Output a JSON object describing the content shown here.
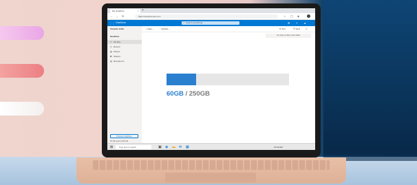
{
  "browser": {
    "tab_title": "My OneDrive",
    "tab_close": "×",
    "new_tab": "+",
    "nav": [
      "←",
      "→",
      "⟳"
    ],
    "url": "https://onedrive.live.com",
    "menu": "⋯"
  },
  "header": {
    "app_title": "OneDrive",
    "search_placeholder": "Search everything",
    "icons": [
      "gear-icon",
      "help-icon",
      "avatar"
    ]
  },
  "sidebar": {
    "user_name": "Vinnette Jellis",
    "section": "OneDrive",
    "items": [
      {
        "label": "My files",
        "icon": "folder-icon",
        "active": true
      },
      {
        "label": "Recent",
        "icon": "clock-icon",
        "active": false
      },
      {
        "label": "Photos",
        "icon": "photo-icon",
        "active": false
      },
      {
        "label": "Shared",
        "icon": "share-icon",
        "active": false
      },
      {
        "label": "Recycle bin",
        "icon": "trash-icon",
        "active": false
      }
    ],
    "premium_button": "Premium OneDrive",
    "storage_line": "60 GB used of 250 GB",
    "get_more": "Get more storage"
  },
  "commandbar": {
    "new": "New",
    "upload": "Upload",
    "sort": "Sort",
    "view": "View",
    "details": "Details"
  },
  "notice": "You have no files in this folder",
  "storage": {
    "used": "60GB",
    "separator": " / ",
    "total": "250GB",
    "used_fraction": 0.24,
    "fill_color": "#2b7fcf"
  },
  "taskbar": {
    "search_placeholder": "Type here to search",
    "time": "10:32 AM"
  }
}
